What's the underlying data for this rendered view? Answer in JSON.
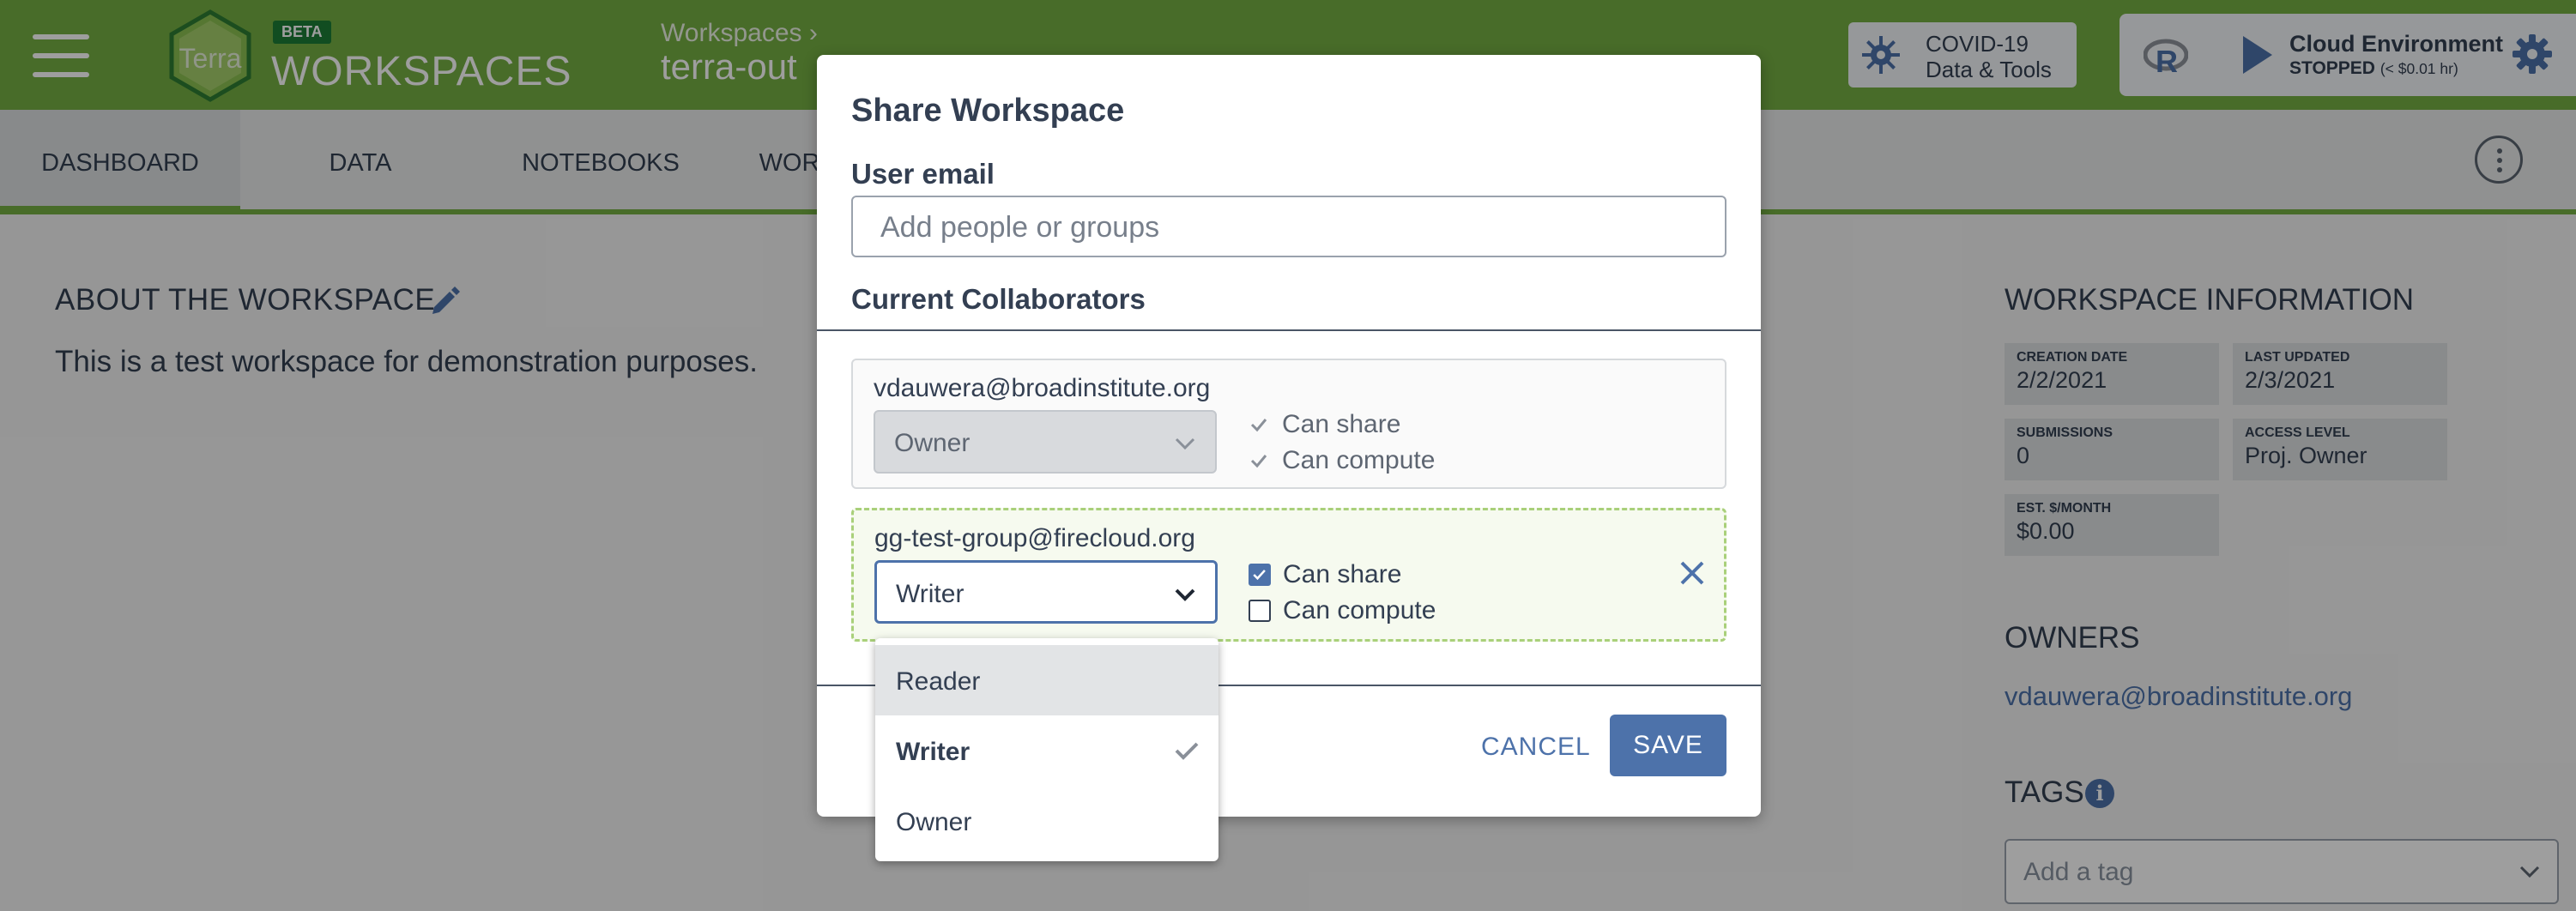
{
  "header": {
    "logo_text": "Terra",
    "beta_badge": "BETA",
    "app_name": "WORKSPACES",
    "breadcrumb": "Workspaces ›",
    "workspace_name": "terra-out",
    "covid_line1": "COVID-19",
    "covid_line2": "Data & Tools",
    "cloud_env_title": "Cloud Environment",
    "cloud_env_status": "STOPPED",
    "cloud_env_cost": "(< $0.01 hr)"
  },
  "tabs": [
    {
      "label": "DASHBOARD",
      "active": true
    },
    {
      "label": "DATA",
      "active": false
    },
    {
      "label": "NOTEBOOKS",
      "active": false
    },
    {
      "label": "WOR",
      "active": false
    }
  ],
  "dashboard": {
    "about_heading": "ABOUT THE WORKSPACE",
    "about_text": "This is a test workspace for demonstration purposes.",
    "info_heading": "WORKSPACE INFORMATION",
    "info": [
      {
        "key": "CREATION DATE",
        "value": "2/2/2021"
      },
      {
        "key": "LAST UPDATED",
        "value": "2/3/2021"
      },
      {
        "key": "SUBMISSIONS",
        "value": "0"
      },
      {
        "key": "ACCESS LEVEL",
        "value": "Proj. Owner"
      },
      {
        "key": "EST. $/MONTH",
        "value": "$0.00"
      }
    ],
    "owners_heading": "OWNERS",
    "owner": "vdauwera@broadinstitute.org",
    "tags_heading": "TAGS",
    "tag_placeholder": "Add a tag"
  },
  "modal": {
    "title": "Share Workspace",
    "email_label": "User email",
    "email_placeholder": "Add people or groups",
    "collab_heading": "Current Collaborators",
    "collaborators": [
      {
        "email": "vdauwera@broadinstitute.org",
        "role": "Owner",
        "can_share": "Can share",
        "can_compute": "Can compute"
      },
      {
        "email": "gg-test-group@firecloud.org",
        "role": "Writer",
        "can_share": "Can share",
        "can_compute": "Can compute"
      }
    ],
    "cancel_label": "CANCEL",
    "save_label": "SAVE"
  },
  "role_menu": {
    "options": [
      "Reader",
      "Writer",
      "Owner"
    ],
    "selected": "Writer",
    "hovered": "Reader"
  },
  "colors": {
    "header_green": "#74ae43",
    "accent_blue": "#4d72aa",
    "text_dark": "#333f52"
  }
}
